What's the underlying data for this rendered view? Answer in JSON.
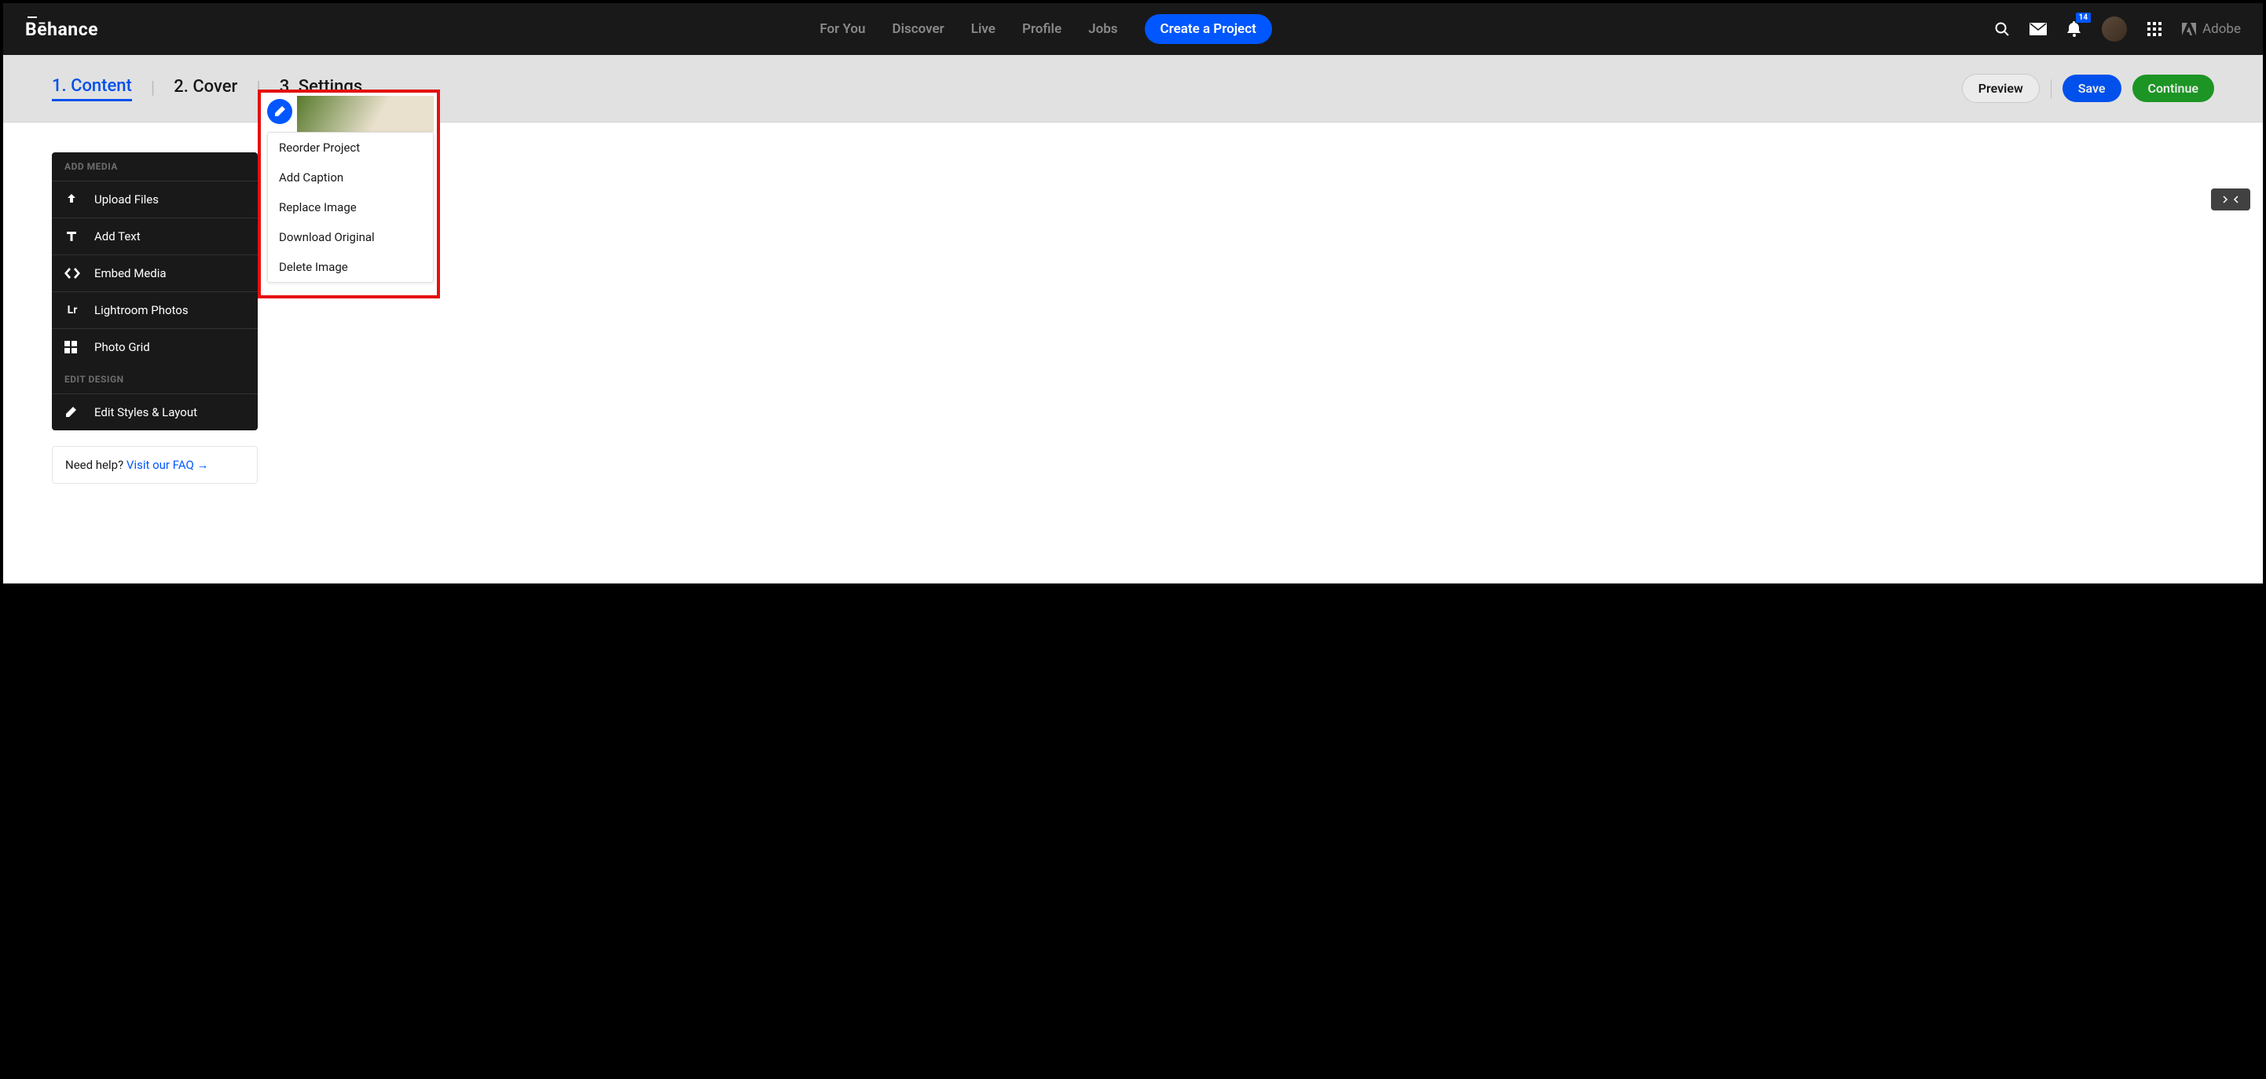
{
  "logo": "Bēhance",
  "nav": {
    "for_you": "For You",
    "discover": "Discover",
    "live": "Live",
    "profile": "Profile",
    "jobs": "Jobs",
    "create": "Create a Project",
    "badge_count": "14",
    "adobe": "Adobe"
  },
  "steps": {
    "content": "1. Content",
    "cover": "2. Cover",
    "settings": "3. Settings"
  },
  "actions": {
    "preview": "Preview",
    "save": "Save",
    "continue": "Continue"
  },
  "sidebar": {
    "add_media_header": "ADD MEDIA",
    "upload": "Upload Files",
    "add_text": "Add Text",
    "embed": "Embed Media",
    "lightroom": "Lightroom Photos",
    "photo_grid": "Photo Grid",
    "edit_design_header": "EDIT DESIGN",
    "edit_styles": "Edit Styles & Layout"
  },
  "help": {
    "prefix": "Need help? ",
    "link": "Visit our FAQ →"
  },
  "edit_menu": {
    "reorder": "Reorder Project",
    "caption": "Add Caption",
    "replace": "Replace Image",
    "download": "Download Original",
    "delete": "Delete Image"
  }
}
